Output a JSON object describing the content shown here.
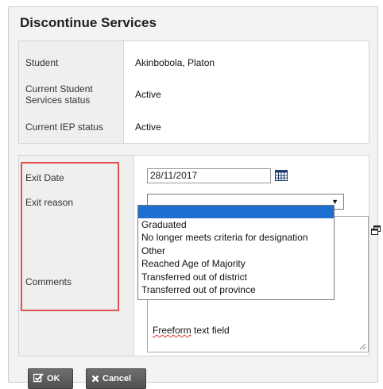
{
  "dialog": {
    "title": "Discontinue Services"
  },
  "info": {
    "student_label": "Student",
    "student_value": "Akinbobola, Platon",
    "services_label": "Current Student Services status",
    "services_value": "Active",
    "iep_label": "Current IEP status",
    "iep_value": "Active"
  },
  "form": {
    "exit_date_label": "Exit Date",
    "exit_date_value": "28/11/2017",
    "exit_reason_label": "Exit reason",
    "exit_reason_value": "",
    "exit_reason_options": [
      "Graduated",
      "No longer meets criteria for designation",
      "Other",
      "Reached Age of Majority",
      "Transferred out of district",
      "Transferred out of province"
    ],
    "comments_label": "Comments",
    "comments_value_word1": "Freeform",
    "comments_value_rest": " text field"
  },
  "buttons": {
    "ok_label": "OK",
    "cancel_label": "Cancel"
  },
  "colors": {
    "highlight": "#e2524a",
    "selected_option": "#1e70d0",
    "button": "#5a5a5a"
  },
  "icons": {
    "calendar": "calendar-icon",
    "ok": "checkbox-icon",
    "cancel": "x-icon",
    "expand": "expand-window-icon"
  }
}
